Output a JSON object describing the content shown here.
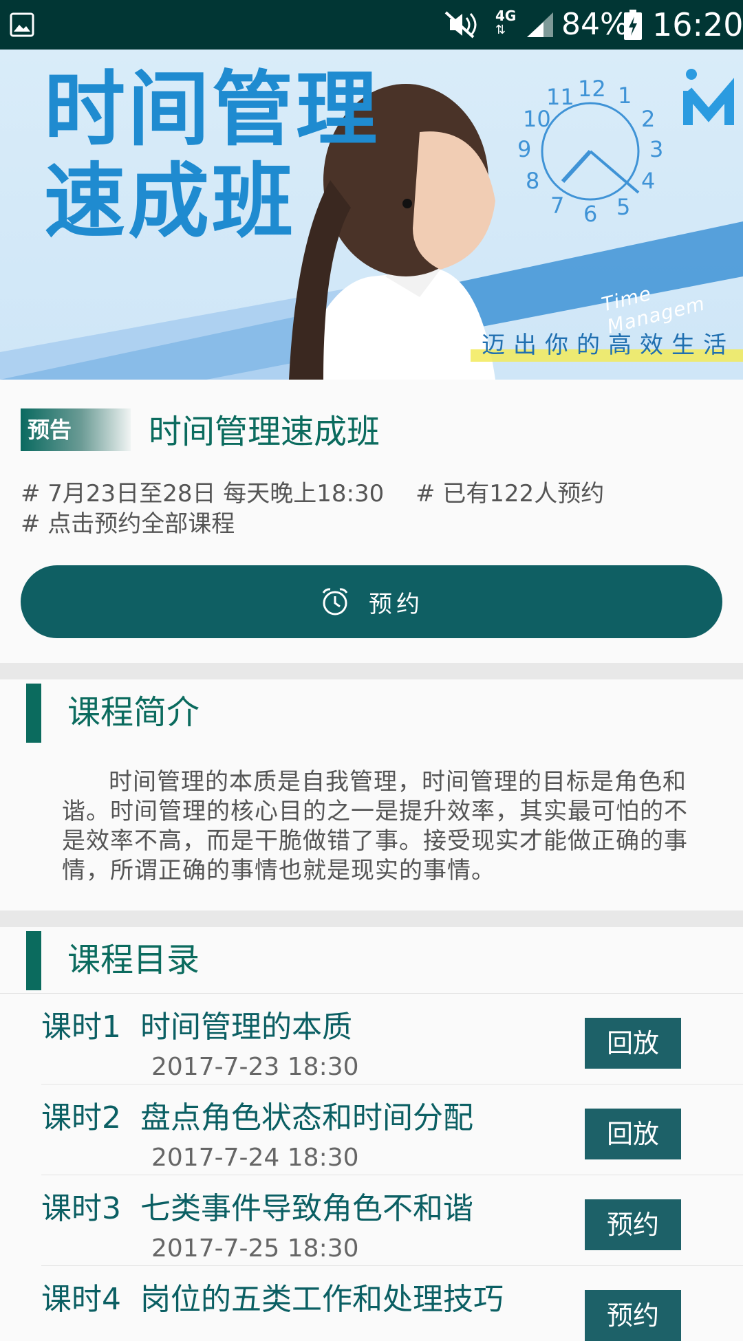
{
  "status_bar": {
    "battery": "84%",
    "time": "16:20",
    "network": "4G",
    "icons": [
      "gallery-icon",
      "mute-icon",
      "network-4g-icon",
      "signal-icon",
      "battery-charging-icon"
    ]
  },
  "banner": {
    "title_line1": "时间管理",
    "title_line2": "速成班",
    "english": "Time Managem",
    "slogan": "迈出你的高效生活",
    "clock_numbers": [
      "12",
      "1",
      "2",
      "3",
      "4",
      "5",
      "6",
      "7",
      "8",
      "9",
      "10",
      "11"
    ]
  },
  "info": {
    "tag": "预告",
    "title": "时间管理速成班",
    "schedule": "# 7月23日至28日 每天晚上18:30",
    "reservations": "# 已有122人预约",
    "hint": "# 点击预约全部课程",
    "book_label": "预约"
  },
  "intro": {
    "heading": "课程简介",
    "text": "时间管理的本质是自我管理，时间管理的目标是角色和谐。时间管理的核心目的之一是提升效率，其实最可怕的不是效率不高，而是干脆做错了事。接受现实才能做正确的事情，所谓正确的事情也就是现实的事情。"
  },
  "catalog": {
    "heading": "课程目录",
    "lessons": [
      {
        "no": "课时1",
        "name": "时间管理的本质",
        "date": "2017-7-23 18:30",
        "action": "回放"
      },
      {
        "no": "课时2",
        "name": "盘点角色状态和时间分配",
        "date": "2017-7-24 18:30",
        "action": "回放"
      },
      {
        "no": "课时3",
        "name": "七类事件导致角色不和谐",
        "date": "2017-7-25 18:30",
        "action": "预约"
      },
      {
        "no": "课时4",
        "name": "岗位的五类工作和处理技巧",
        "date": "",
        "action": "预约"
      }
    ]
  },
  "colors": {
    "status_bar_bg": "#013634",
    "primary": "#0b6b5e",
    "button": "#0f5f63",
    "banner_bg": "#d9ecf9",
    "banner_text": "#1f8bd0"
  }
}
